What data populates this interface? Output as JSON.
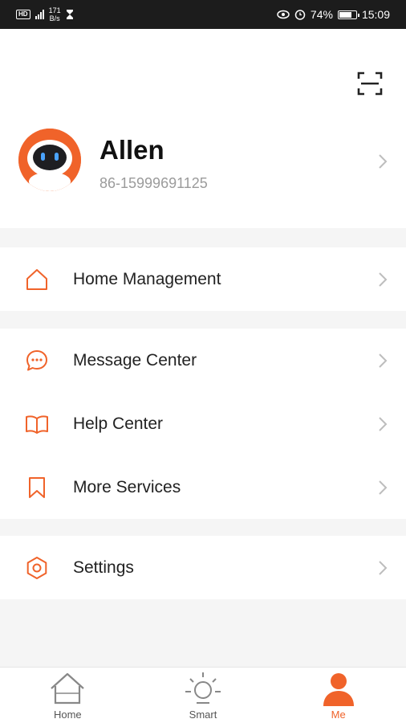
{
  "status_bar": {
    "network_type": "HD",
    "net_speed_value": "171",
    "net_speed_unit": "B/s",
    "battery": "74%",
    "battery_level": 0.74,
    "time": "15:09"
  },
  "profile": {
    "name": "Allen",
    "phone": "86-15999691125"
  },
  "colors": {
    "accent": "#f0632a",
    "background": "#f5f5f5"
  },
  "menu": {
    "home_management": {
      "label": "Home Management",
      "icon": "home-icon"
    },
    "message_center": {
      "label": "Message Center",
      "icon": "message-icon"
    },
    "help_center": {
      "label": "Help Center",
      "icon": "book-icon"
    },
    "more_services": {
      "label": "More Services",
      "icon": "bookmark-icon"
    },
    "settings": {
      "label": "Settings",
      "icon": "hexagon-settings-icon"
    }
  },
  "tabs": [
    {
      "label": "Home",
      "icon": "house-icon",
      "active": false
    },
    {
      "label": "Smart",
      "icon": "sun-icon",
      "active": false
    },
    {
      "label": "Me",
      "icon": "person-icon",
      "active": true
    }
  ]
}
